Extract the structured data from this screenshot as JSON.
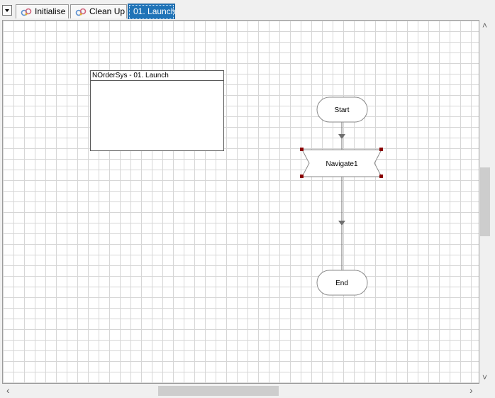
{
  "tabs": [
    {
      "label": "Initialise",
      "icon": "process-icon",
      "active": false
    },
    {
      "label": "Clean Up",
      "icon": "process-icon",
      "active": false
    },
    {
      "label": "01. Launch",
      "active": true
    }
  ],
  "note": {
    "title": "NOrderSys - 01. Launch"
  },
  "stages": {
    "start": "Start",
    "navigate": "Navigate1",
    "end": "End"
  },
  "colors": {
    "active_tab": "#1f73b7",
    "selection_handle": "#8b0000",
    "grid_line": "#d6d6d6",
    "connector": "#6e6e6e"
  },
  "scrollbars": {
    "left_arrow": "‹",
    "right_arrow": "›",
    "up_arrow": "˄",
    "down_arrow": "˅"
  }
}
